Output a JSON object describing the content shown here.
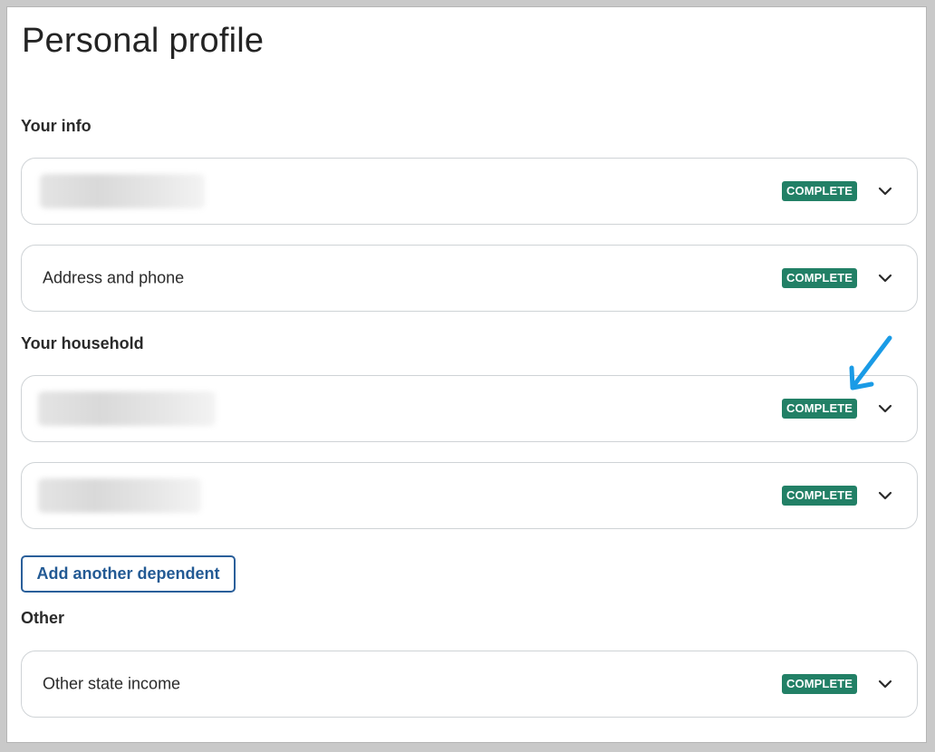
{
  "page": {
    "title": "Personal profile"
  },
  "sections": {
    "your_info": "Your info",
    "your_household": "Your household",
    "other": "Other"
  },
  "cards": {
    "address": {
      "label": "Address and phone",
      "status": "COMPLETE"
    },
    "info_redacted": {
      "status": "COMPLETE"
    },
    "household_1": {
      "status": "COMPLETE"
    },
    "household_2": {
      "status": "COMPLETE"
    },
    "other_state": {
      "label": "Other state income",
      "status": "COMPLETE"
    }
  },
  "buttons": {
    "add_dependent": "Add another dependent"
  },
  "colors": {
    "badge": "#228066",
    "link": "#235a94",
    "annotation_arrow": "#1a9be6"
  },
  "icons": {
    "expand": "chevron-down-icon",
    "annotation": "arrow-icon"
  }
}
